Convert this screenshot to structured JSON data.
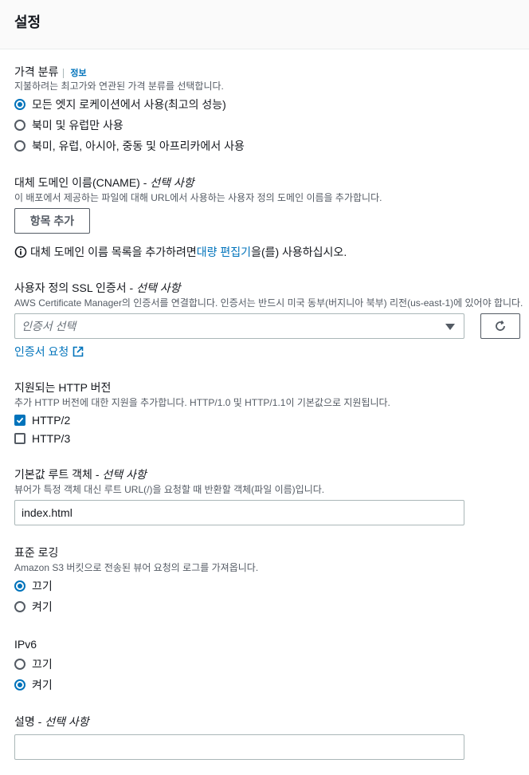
{
  "header": {
    "title": "설정"
  },
  "price_class": {
    "label": "가격 분류",
    "info": "정보",
    "description": "지불하려는 최고가와 연관된 가격 분류를 선택합니다.",
    "options": [
      {
        "label": "모든 엣지 로케이션에서 사용(최고의 성능)",
        "selected": true
      },
      {
        "label": "북미 및 유럽만 사용",
        "selected": false
      },
      {
        "label": "북미, 유럽, 아시아, 중동 및 아프리카에서 사용",
        "selected": false
      }
    ]
  },
  "cname": {
    "label": "대체 도메인 이름(CNAME) - ",
    "optional": "선택 사항",
    "description": "이 배포에서 제공하는 파일에 대해 URL에서 사용하는 사용자 정의 도메인 이름을 추가합니다.",
    "add_button": "항목 추가",
    "notice_before": "대체 도메인 이름 목록을 추가하려면 ",
    "notice_link": "대량 편집기",
    "notice_after": "을(를) 사용하십시오."
  },
  "ssl": {
    "label": "사용자 정의 SSL 인증서 - ",
    "optional": "선택 사항",
    "description": "AWS Certificate Manager의 인증서를 연결합니다. 인증서는 반드시 미국 동부(버지니아 북부) 리전(us-east-1)에 있어야 합니다.",
    "select_placeholder": "인증서 선택",
    "request_link": "인증서 요청"
  },
  "http": {
    "label": "지원되는 HTTP 버전",
    "description": "추가 HTTP 버전에 대한 지원을 추가합니다. HTTP/1.0 및 HTTP/1.1이 기본값으로 지원됩니다.",
    "options": [
      {
        "label": "HTTP/2",
        "checked": true
      },
      {
        "label": "HTTP/3",
        "checked": false
      }
    ]
  },
  "root_object": {
    "label": "기본값 루트 객체 - ",
    "optional": "선택 사항",
    "description": "뷰어가 특정 객체 대신 루트 URL(/)을 요청할 때 반환할 객체(파일 이름)입니다.",
    "value": "index.html"
  },
  "logging": {
    "label": "표준 로깅",
    "description": "Amazon S3 버킷으로 전송된 뷰어 요청의 로그를 가져옵니다.",
    "options": [
      {
        "label": "끄기",
        "selected": true
      },
      {
        "label": "켜기",
        "selected": false
      }
    ]
  },
  "ipv6": {
    "label": "IPv6",
    "options": [
      {
        "label": "끄기",
        "selected": false
      },
      {
        "label": "켜기",
        "selected": true
      }
    ]
  },
  "description_field": {
    "label": "설명 - ",
    "optional": "선택 사항",
    "value": ""
  },
  "colors": {
    "accent": "#0073bb",
    "text": "#16191f",
    "muted": "#545b64",
    "border": "#aab7b8"
  }
}
